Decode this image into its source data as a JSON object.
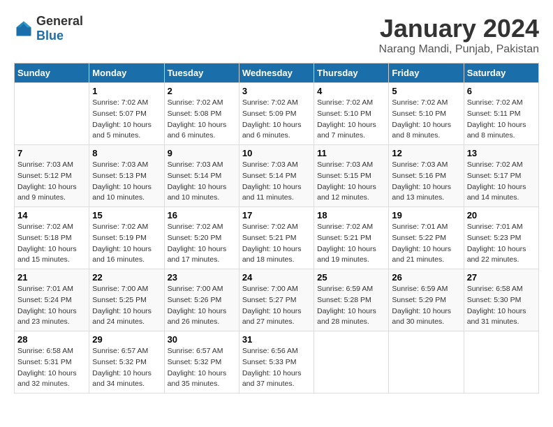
{
  "logo": {
    "general": "General",
    "blue": "Blue"
  },
  "title": "January 2024",
  "location": "Narang Mandi, Punjab, Pakistan",
  "days_header": [
    "Sunday",
    "Monday",
    "Tuesday",
    "Wednesday",
    "Thursday",
    "Friday",
    "Saturday"
  ],
  "weeks": [
    [
      {
        "day": "",
        "info": ""
      },
      {
        "day": "1",
        "info": "Sunrise: 7:02 AM\nSunset: 5:07 PM\nDaylight: 10 hours\nand 5 minutes."
      },
      {
        "day": "2",
        "info": "Sunrise: 7:02 AM\nSunset: 5:08 PM\nDaylight: 10 hours\nand 6 minutes."
      },
      {
        "day": "3",
        "info": "Sunrise: 7:02 AM\nSunset: 5:09 PM\nDaylight: 10 hours\nand 6 minutes."
      },
      {
        "day": "4",
        "info": "Sunrise: 7:02 AM\nSunset: 5:10 PM\nDaylight: 10 hours\nand 7 minutes."
      },
      {
        "day": "5",
        "info": "Sunrise: 7:02 AM\nSunset: 5:10 PM\nDaylight: 10 hours\nand 8 minutes."
      },
      {
        "day": "6",
        "info": "Sunrise: 7:02 AM\nSunset: 5:11 PM\nDaylight: 10 hours\nand 8 minutes."
      }
    ],
    [
      {
        "day": "7",
        "info": "Sunrise: 7:03 AM\nSunset: 5:12 PM\nDaylight: 10 hours\nand 9 minutes."
      },
      {
        "day": "8",
        "info": "Sunrise: 7:03 AM\nSunset: 5:13 PM\nDaylight: 10 hours\nand 10 minutes."
      },
      {
        "day": "9",
        "info": "Sunrise: 7:03 AM\nSunset: 5:14 PM\nDaylight: 10 hours\nand 10 minutes."
      },
      {
        "day": "10",
        "info": "Sunrise: 7:03 AM\nSunset: 5:14 PM\nDaylight: 10 hours\nand 11 minutes."
      },
      {
        "day": "11",
        "info": "Sunrise: 7:03 AM\nSunset: 5:15 PM\nDaylight: 10 hours\nand 12 minutes."
      },
      {
        "day": "12",
        "info": "Sunrise: 7:03 AM\nSunset: 5:16 PM\nDaylight: 10 hours\nand 13 minutes."
      },
      {
        "day": "13",
        "info": "Sunrise: 7:02 AM\nSunset: 5:17 PM\nDaylight: 10 hours\nand 14 minutes."
      }
    ],
    [
      {
        "day": "14",
        "info": "Sunrise: 7:02 AM\nSunset: 5:18 PM\nDaylight: 10 hours\nand 15 minutes."
      },
      {
        "day": "15",
        "info": "Sunrise: 7:02 AM\nSunset: 5:19 PM\nDaylight: 10 hours\nand 16 minutes."
      },
      {
        "day": "16",
        "info": "Sunrise: 7:02 AM\nSunset: 5:20 PM\nDaylight: 10 hours\nand 17 minutes."
      },
      {
        "day": "17",
        "info": "Sunrise: 7:02 AM\nSunset: 5:21 PM\nDaylight: 10 hours\nand 18 minutes."
      },
      {
        "day": "18",
        "info": "Sunrise: 7:02 AM\nSunset: 5:21 PM\nDaylight: 10 hours\nand 19 minutes."
      },
      {
        "day": "19",
        "info": "Sunrise: 7:01 AM\nSunset: 5:22 PM\nDaylight: 10 hours\nand 21 minutes."
      },
      {
        "day": "20",
        "info": "Sunrise: 7:01 AM\nSunset: 5:23 PM\nDaylight: 10 hours\nand 22 minutes."
      }
    ],
    [
      {
        "day": "21",
        "info": "Sunrise: 7:01 AM\nSunset: 5:24 PM\nDaylight: 10 hours\nand 23 minutes."
      },
      {
        "day": "22",
        "info": "Sunrise: 7:00 AM\nSunset: 5:25 PM\nDaylight: 10 hours\nand 24 minutes."
      },
      {
        "day": "23",
        "info": "Sunrise: 7:00 AM\nSunset: 5:26 PM\nDaylight: 10 hours\nand 26 minutes."
      },
      {
        "day": "24",
        "info": "Sunrise: 7:00 AM\nSunset: 5:27 PM\nDaylight: 10 hours\nand 27 minutes."
      },
      {
        "day": "25",
        "info": "Sunrise: 6:59 AM\nSunset: 5:28 PM\nDaylight: 10 hours\nand 28 minutes."
      },
      {
        "day": "26",
        "info": "Sunrise: 6:59 AM\nSunset: 5:29 PM\nDaylight: 10 hours\nand 30 minutes."
      },
      {
        "day": "27",
        "info": "Sunrise: 6:58 AM\nSunset: 5:30 PM\nDaylight: 10 hours\nand 31 minutes."
      }
    ],
    [
      {
        "day": "28",
        "info": "Sunrise: 6:58 AM\nSunset: 5:31 PM\nDaylight: 10 hours\nand 32 minutes."
      },
      {
        "day": "29",
        "info": "Sunrise: 6:57 AM\nSunset: 5:32 PM\nDaylight: 10 hours\nand 34 minutes."
      },
      {
        "day": "30",
        "info": "Sunrise: 6:57 AM\nSunset: 5:32 PM\nDaylight: 10 hours\nand 35 minutes."
      },
      {
        "day": "31",
        "info": "Sunrise: 6:56 AM\nSunset: 5:33 PM\nDaylight: 10 hours\nand 37 minutes."
      },
      {
        "day": "",
        "info": ""
      },
      {
        "day": "",
        "info": ""
      },
      {
        "day": "",
        "info": ""
      }
    ]
  ]
}
